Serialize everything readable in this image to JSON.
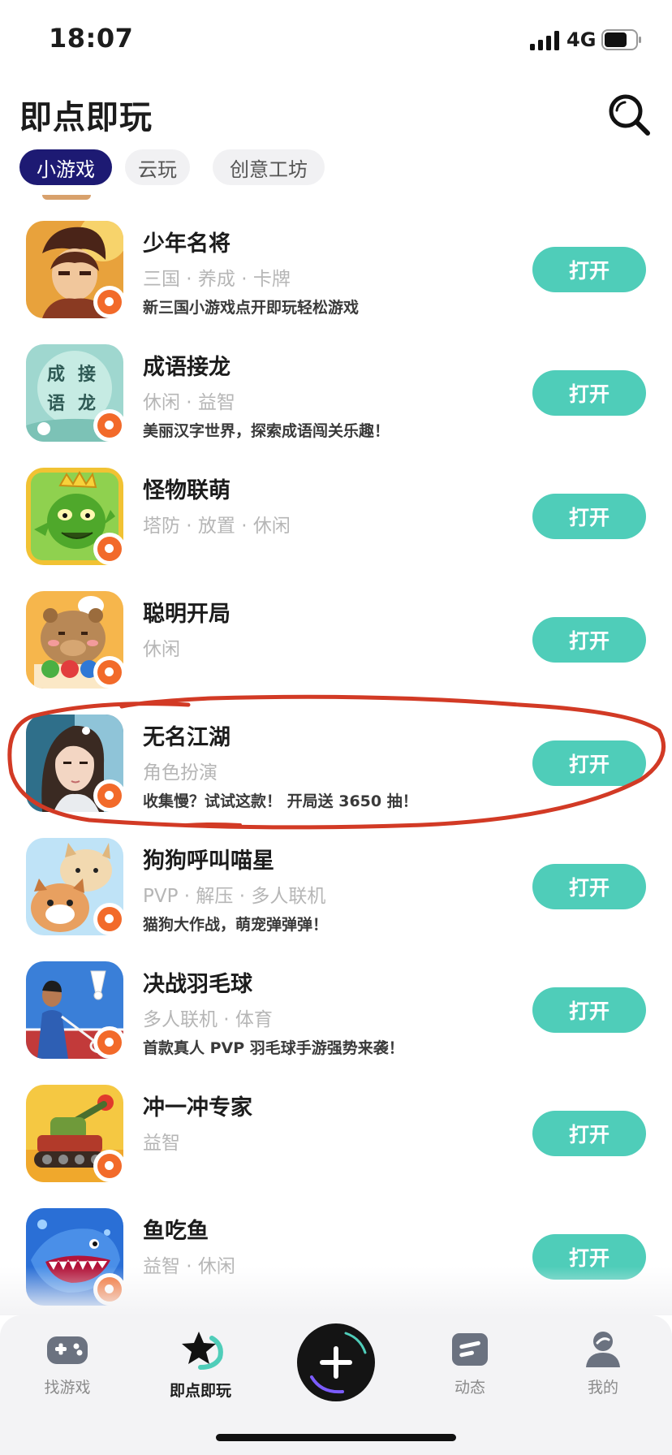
{
  "status_bar": {
    "time": "18:07",
    "network": "4G"
  },
  "header": {
    "title": "即点即玩"
  },
  "tabs": [
    {
      "label": "小游戏",
      "active": true
    },
    {
      "label": "云玩",
      "active": false
    },
    {
      "label": "创意工坊",
      "active": false
    }
  ],
  "games": [
    {
      "name": "少年名将",
      "tags": "三国 · 养成 · 卡牌",
      "desc": "新三国小游戏点开即玩轻松游戏",
      "button": "打开",
      "icon": "hero-portrait-icon"
    },
    {
      "name": "成语接龙",
      "tags": "休闲 · 益智",
      "desc": "美丽汉字世界，探索成语闯关乐趣！",
      "button": "打开",
      "icon": "idiom-chain-icon",
      "icon_text": [
        "成",
        "接",
        "语",
        "龙"
      ]
    },
    {
      "name": "怪物联萌",
      "tags": "塔防 · 放置 · 休闲",
      "desc": "",
      "button": "打开",
      "icon": "green-monster-icon"
    },
    {
      "name": "聪明开局",
      "tags": "休闲",
      "desc": "",
      "button": "打开",
      "icon": "capybara-icon"
    },
    {
      "name": "无名江湖",
      "tags": "角色扮演",
      "desc": "收集慢？试试这款！ 开局送 3650 抽！",
      "button": "打开",
      "icon": "heroine-portrait-icon"
    },
    {
      "name": "狗狗呼叫喵星",
      "tags": "PVP · 解压 · 多人联机",
      "desc": "猫狗大作战，萌宠弹弹弹！",
      "button": "打开",
      "icon": "cat-dog-icon"
    },
    {
      "name": "决战羽毛球",
      "tags": "多人联机 · 体育",
      "desc": "首款真人 PVP 羽毛球手游强势来袭！",
      "button": "打开",
      "icon": "badminton-icon"
    },
    {
      "name": "冲一冲专家",
      "tags": "益智",
      "desc": "",
      "button": "打开",
      "icon": "tank-icon"
    },
    {
      "name": "鱼吃鱼",
      "tags": "益智 · 休闲",
      "desc": "",
      "button": "打开",
      "icon": "shark-icon"
    }
  ],
  "bottom_nav": [
    {
      "label": "找游戏",
      "icon": "gamepad-icon",
      "active": false
    },
    {
      "label": "即点即玩",
      "icon": "star-icon",
      "active": true
    },
    {
      "label": "",
      "icon": "plus-icon",
      "active": false
    },
    {
      "label": "动态",
      "icon": "feed-icon",
      "active": false
    },
    {
      "label": "我的",
      "icon": "profile-icon",
      "active": false
    }
  ],
  "colors": {
    "accent": "#4fcdb9",
    "tab_active": "#1d1a73",
    "annotation": "#d23a25",
    "badge": "#f26a2a"
  }
}
